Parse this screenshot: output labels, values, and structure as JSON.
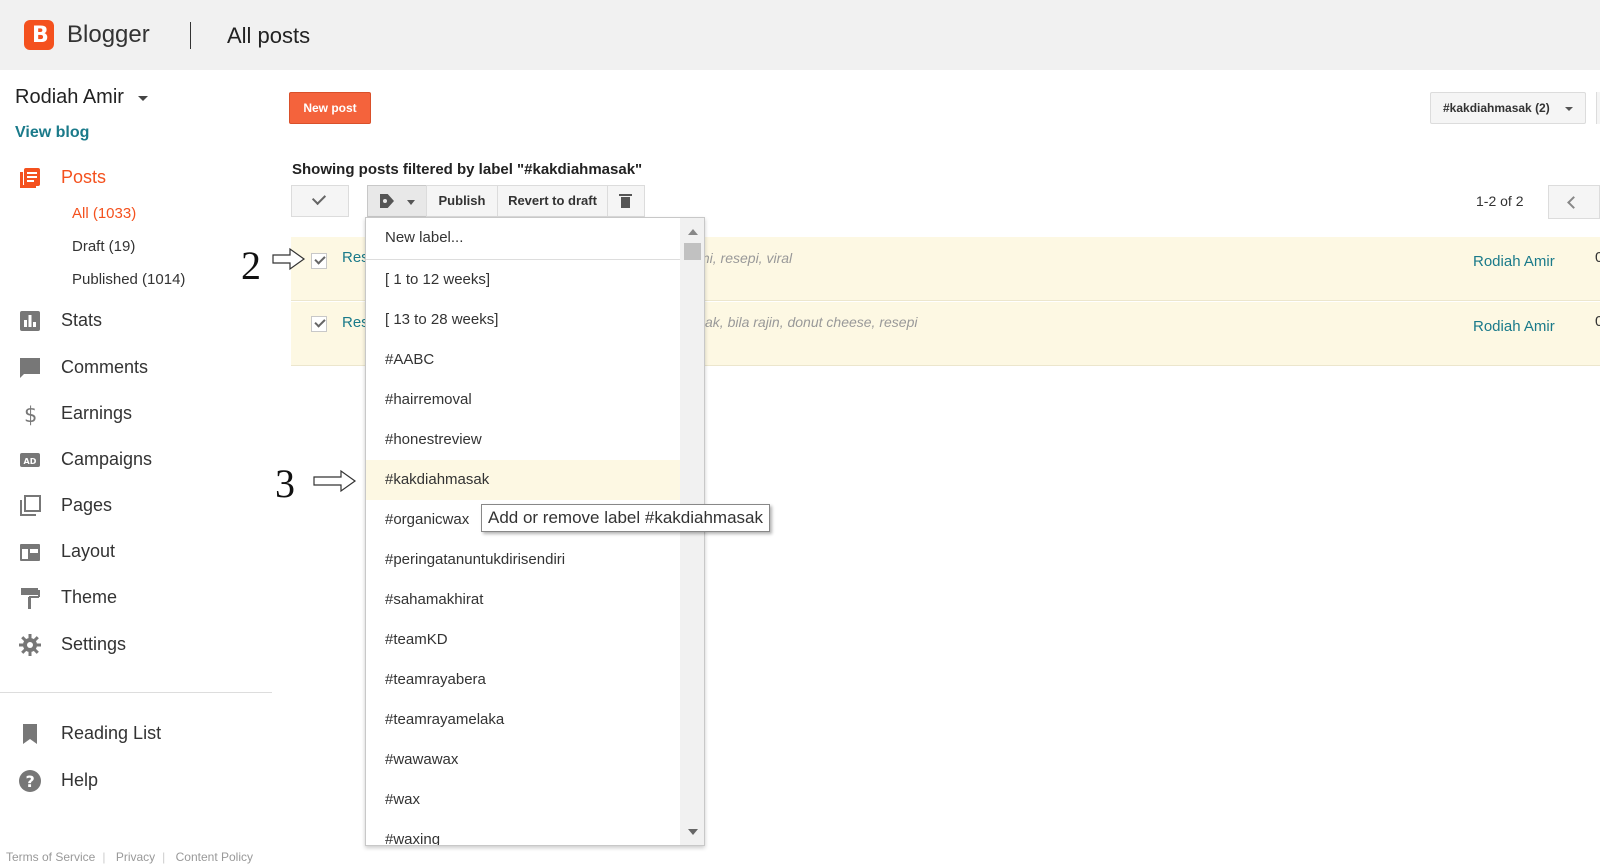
{
  "header": {
    "brand": "Blogger",
    "page_title": "All posts"
  },
  "sidebar": {
    "blog_name": "Rodiah Amir",
    "view_blog": "View blog",
    "posts_label": "Posts",
    "post_filters": [
      "All (1033)",
      "Draft (19)",
      "Published (1014)"
    ],
    "nav": [
      "Stats",
      "Comments",
      "Earnings",
      "Campaigns",
      "Pages",
      "Layout",
      "Theme",
      "Settings"
    ],
    "secondary": [
      "Reading List",
      "Help"
    ],
    "footer": [
      "Terms of Service",
      "Privacy",
      "Content Policy"
    ]
  },
  "toolbar": {
    "new_post": "New post",
    "label_filter": "#kakdiahmasak (2)",
    "filter_text": "Showing posts filtered by label \"#kakdiahmasak\"",
    "publish": "Publish",
    "revert": "Revert to draft",
    "pager": "1-2 of 2"
  },
  "posts": [
    {
      "title": "Res",
      "labels": "mi, resepi, viral",
      "author": "Rodiah Amir",
      "edge": "0",
      "checked": true
    },
    {
      "title": "Res",
      "labels": "sak, bila rajin, donut cheese, resepi",
      "author": "Rodiah Amir",
      "edge": "0",
      "checked": true
    }
  ],
  "label_menu": {
    "new_label": "New label...",
    "items": [
      "[ 1 to 12 weeks]",
      "[ 13 to 28 weeks]",
      "#AABC",
      "#hairremoval",
      "#honestreview",
      "#kakdiahmasak",
      "#organicwax",
      "#peringatanuntukdirisendiri",
      "#sahamakhirat",
      "#teamKD",
      "#teamrayabera",
      "#teamrayamelaka",
      "#wawawax",
      "#wax",
      "#waxing"
    ],
    "highlighted": "#kakdiahmasak",
    "tooltip": "Add or remove label #kakdiahmasak"
  },
  "annotations": [
    "2",
    "3"
  ],
  "colors": {
    "accent": "#f4511e",
    "link": "#1a7a8a",
    "row_highlight": "#fdf8e3"
  }
}
